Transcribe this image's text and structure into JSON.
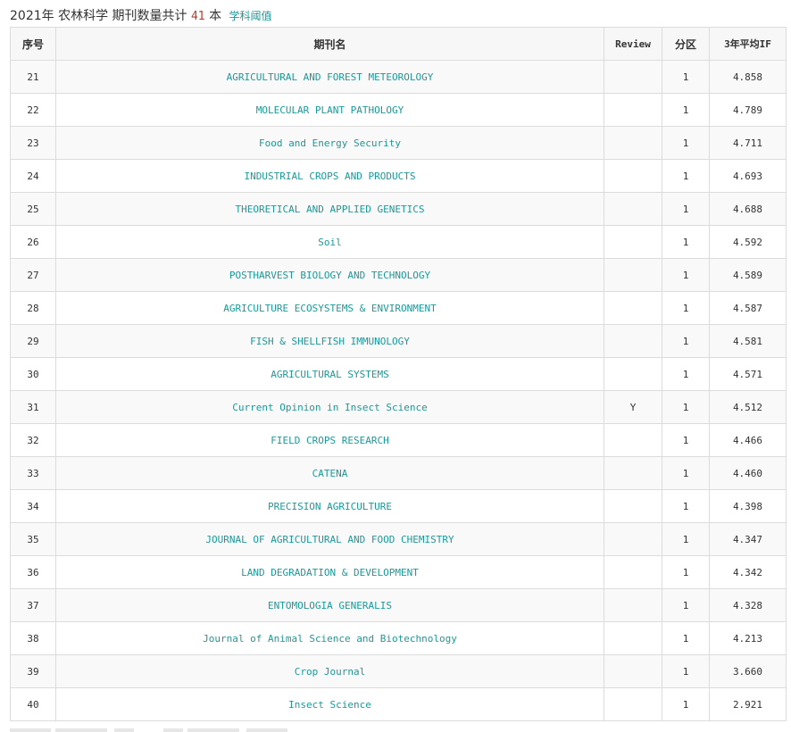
{
  "caption": {
    "prefix": "2021年 农林科学 期刊数量共计",
    "count": "41",
    "unit": "本",
    "link": "学科阈值"
  },
  "table": {
    "headers": {
      "index": "序号",
      "journal": "期刊名",
      "review": "Review",
      "zone": "分区",
      "if": "3年平均IF"
    },
    "rows": [
      {
        "index": "21",
        "journal": "AGRICULTURAL AND FOREST METEOROLOGY",
        "review": "",
        "zone": "1",
        "if": "4.858"
      },
      {
        "index": "22",
        "journal": "MOLECULAR PLANT PATHOLOGY",
        "review": "",
        "zone": "1",
        "if": "4.789"
      },
      {
        "index": "23",
        "journal": "Food and Energy Security",
        "review": "",
        "zone": "1",
        "if": "4.711"
      },
      {
        "index": "24",
        "journal": "INDUSTRIAL CROPS AND PRODUCTS",
        "review": "",
        "zone": "1",
        "if": "4.693"
      },
      {
        "index": "25",
        "journal": "THEORETICAL AND APPLIED GENETICS",
        "review": "",
        "zone": "1",
        "if": "4.688"
      },
      {
        "index": "26",
        "journal": "Soil",
        "review": "",
        "zone": "1",
        "if": "4.592"
      },
      {
        "index": "27",
        "journal": "POSTHARVEST BIOLOGY AND TECHNOLOGY",
        "review": "",
        "zone": "1",
        "if": "4.589"
      },
      {
        "index": "28",
        "journal": "AGRICULTURE ECOSYSTEMS & ENVIRONMENT",
        "review": "",
        "zone": "1",
        "if": "4.587"
      },
      {
        "index": "29",
        "journal": "FISH & SHELLFISH IMMUNOLOGY",
        "review": "",
        "zone": "1",
        "if": "4.581"
      },
      {
        "index": "30",
        "journal": "AGRICULTURAL SYSTEMS",
        "review": "",
        "zone": "1",
        "if": "4.571"
      },
      {
        "index": "31",
        "journal": "Current Opinion in Insect Science",
        "review": "Y",
        "zone": "1",
        "if": "4.512"
      },
      {
        "index": "32",
        "journal": "FIELD CROPS RESEARCH",
        "review": "",
        "zone": "1",
        "if": "4.466"
      },
      {
        "index": "33",
        "journal": "CATENA",
        "review": "",
        "zone": "1",
        "if": "4.460"
      },
      {
        "index": "34",
        "journal": "PRECISION AGRICULTURE",
        "review": "",
        "zone": "1",
        "if": "4.398"
      },
      {
        "index": "35",
        "journal": "JOURNAL OF AGRICULTURAL AND FOOD CHEMISTRY",
        "review": "",
        "zone": "1",
        "if": "4.347"
      },
      {
        "index": "36",
        "journal": "LAND DEGRADATION & DEVELOPMENT",
        "review": "",
        "zone": "1",
        "if": "4.342"
      },
      {
        "index": "37",
        "journal": "ENTOMOLOGIA GENERALIS",
        "review": "",
        "zone": "1",
        "if": "4.328"
      },
      {
        "index": "38",
        "journal": "Journal of Animal Science and Biotechnology",
        "review": "",
        "zone": "1",
        "if": "4.213"
      },
      {
        "index": "39",
        "journal": "Crop Journal",
        "review": "",
        "zone": "1",
        "if": "3.660"
      },
      {
        "index": "40",
        "journal": "Insect Science",
        "review": "",
        "zone": "1",
        "if": "2.921"
      }
    ]
  }
}
